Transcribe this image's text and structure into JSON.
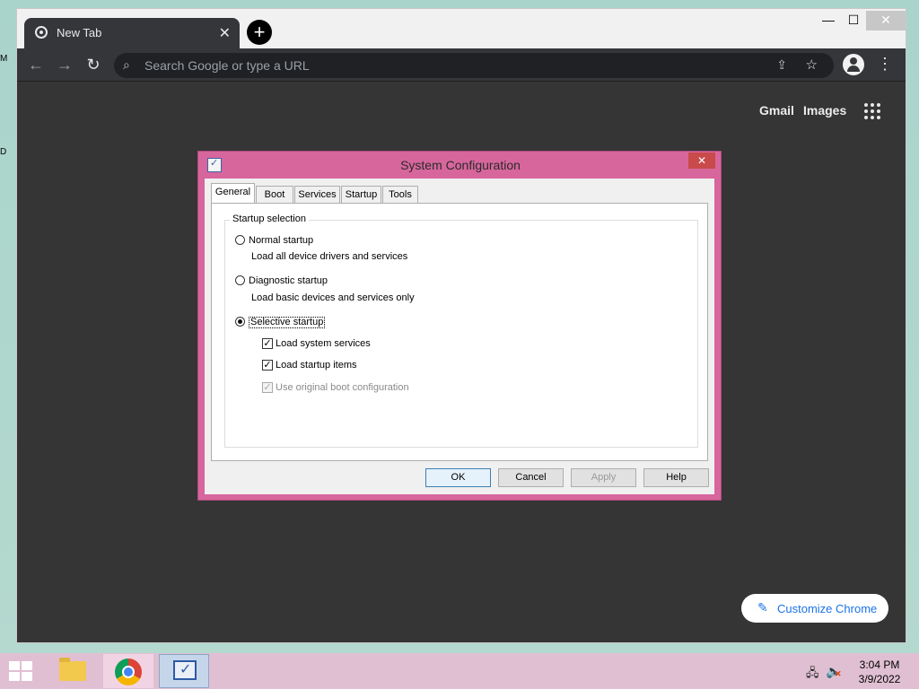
{
  "desktop": {
    "fragments": [
      "M",
      "D"
    ]
  },
  "browser": {
    "tab_title": "New Tab",
    "tab_close": "✕",
    "new_tab": "+",
    "window_controls": {
      "minimize": "—",
      "maximize": "☐",
      "close": "✕"
    },
    "nav": {
      "back": "←",
      "forward": "→",
      "reload": "↻"
    },
    "omnibox": {
      "placeholder": "Search Google or type a URL"
    },
    "top_links": {
      "gmail": "Gmail",
      "images": "Images"
    },
    "customize_label": "Customize Chrome"
  },
  "dialog": {
    "title": "System Configuration",
    "close": "✕",
    "tabs": [
      "General",
      "Boot",
      "Services",
      "Startup",
      "Tools"
    ],
    "active_tab": "General",
    "group_label": "Startup selection",
    "options": {
      "normal": {
        "label": "Normal startup",
        "description": "Load all device drivers and services",
        "selected": false
      },
      "diagnostic": {
        "label": "Diagnostic startup",
        "description": "Load basic devices and services only",
        "selected": false
      },
      "selective": {
        "label": "Selective startup",
        "selected": true
      }
    },
    "checkboxes": {
      "system_services": {
        "label": "Load system services",
        "checked": true,
        "enabled": true
      },
      "startup_items": {
        "label": "Load startup items",
        "checked": true,
        "enabled": true
      },
      "original_boot": {
        "label": "Use original boot configuration",
        "checked": true,
        "enabled": false
      }
    },
    "buttons": {
      "ok": "OK",
      "cancel": "Cancel",
      "apply": "Apply",
      "help": "Help"
    }
  },
  "taskbar": {
    "items": [
      "file-explorer",
      "google-chrome",
      "system-configuration"
    ],
    "clock": {
      "time": "3:04 PM",
      "date": "3/9/2022"
    }
  },
  "colors": {
    "dialog_frame": "#d7669d",
    "browser_dark": "#353535",
    "taskbar": "#e0bfd2",
    "accent_blue": "#1a73e8"
  }
}
